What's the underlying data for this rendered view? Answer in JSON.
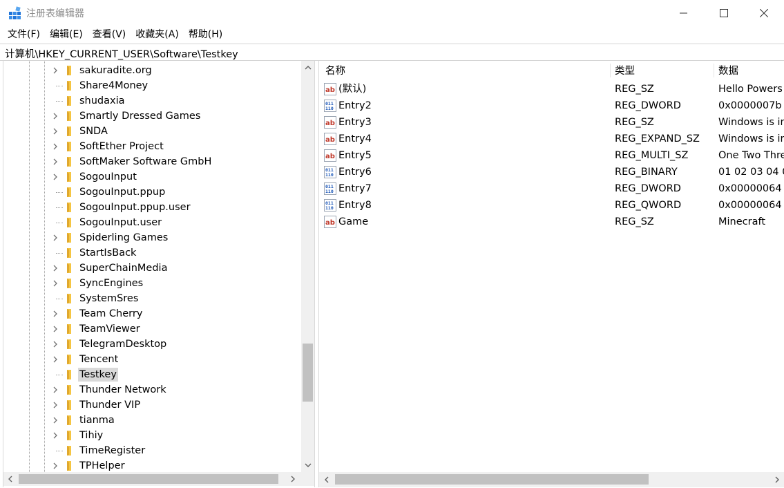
{
  "window": {
    "title": "注册表编辑器"
  },
  "menu": [
    {
      "label": "文件(F)",
      "key": "file"
    },
    {
      "label": "编辑(E)",
      "key": "edit"
    },
    {
      "label": "查看(V)",
      "key": "view"
    },
    {
      "label": "收藏夹(A)",
      "key": "favorites"
    },
    {
      "label": "帮助(H)",
      "key": "help"
    }
  ],
  "address": {
    "path": "计算机\\HKEY_CURRENT_USER\\Software\\Testkey"
  },
  "tree": {
    "items": [
      {
        "label": "sakuradite.org",
        "expandable": true
      },
      {
        "label": "Share4Money",
        "expandable": false
      },
      {
        "label": "shudaxia",
        "expandable": false
      },
      {
        "label": "Smartly Dressed Games",
        "expandable": true
      },
      {
        "label": "SNDA",
        "expandable": true
      },
      {
        "label": "SoftEther Project",
        "expandable": true
      },
      {
        "label": "SoftMaker Software GmbH",
        "expandable": true
      },
      {
        "label": "SogouInput",
        "expandable": true
      },
      {
        "label": "SogouInput.ppup",
        "expandable": false
      },
      {
        "label": "SogouInput.ppup.user",
        "expandable": false
      },
      {
        "label": "SogouInput.user",
        "expandable": false
      },
      {
        "label": "Spiderling Games",
        "expandable": true
      },
      {
        "label": "StartIsBack",
        "expandable": false
      },
      {
        "label": "SuperChainMedia",
        "expandable": true
      },
      {
        "label": "SyncEngines",
        "expandable": true
      },
      {
        "label": "SystemSres",
        "expandable": false
      },
      {
        "label": "Team Cherry",
        "expandable": true
      },
      {
        "label": "TeamViewer",
        "expandable": true
      },
      {
        "label": "TelegramDesktop",
        "expandable": true
      },
      {
        "label": "Tencent",
        "expandable": true
      },
      {
        "label": "Testkey",
        "expandable": false,
        "selected": true
      },
      {
        "label": "Thunder Network",
        "expandable": true
      },
      {
        "label": "Thunder VIP",
        "expandable": true
      },
      {
        "label": "tianma",
        "expandable": true
      },
      {
        "label": "Tihiy",
        "expandable": true
      },
      {
        "label": "TimeRegister",
        "expandable": false
      },
      {
        "label": "TPHelper",
        "expandable": true
      }
    ]
  },
  "values": {
    "columns": {
      "name": "名称",
      "type": "类型",
      "data": "数据"
    },
    "rows": [
      {
        "icon": "string-value-icon",
        "name": "(默认)",
        "type": "REG_SZ",
        "data": "Hello Powers"
      },
      {
        "icon": "binary-value-icon",
        "name": "Entry2",
        "type": "REG_DWORD",
        "data": "0x0000007b"
      },
      {
        "icon": "string-value-icon",
        "name": "Entry3",
        "type": "REG_SZ",
        "data": "Windows is in"
      },
      {
        "icon": "string-value-icon",
        "name": "Entry4",
        "type": "REG_EXPAND_SZ",
        "data": "Windows is in"
      },
      {
        "icon": "string-value-icon",
        "name": "Entry5",
        "type": "REG_MULTI_SZ",
        "data": "One Two Thre"
      },
      {
        "icon": "binary-value-icon",
        "name": "Entry6",
        "type": "REG_BINARY",
        "data": "01 02 03 04 0"
      },
      {
        "icon": "binary-value-icon",
        "name": "Entry7",
        "type": "REG_DWORD",
        "data": "0x00000064 ("
      },
      {
        "icon": "binary-value-icon",
        "name": "Entry8",
        "type": "REG_QWORD",
        "data": "0x00000064 ("
      },
      {
        "icon": "string-value-icon",
        "name": "Game",
        "type": "REG_SZ",
        "data": "Minecraft"
      }
    ]
  },
  "colors": {
    "folder": "#f5c542",
    "string_icon_red": "#c0392b",
    "binary_icon_blue": "#1a56b8",
    "selection": "#d9d9d9",
    "scroll_thumb": "#c1c1c1"
  }
}
